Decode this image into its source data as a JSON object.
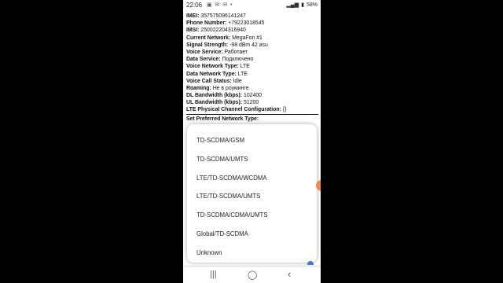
{
  "status": {
    "time": "22:06",
    "notifications": "▣ ✉ ✉ •",
    "battery": "58%"
  },
  "info": {
    "rows": [
      {
        "label": "IMEI:",
        "value": " 357575096141247"
      },
      {
        "label": "Phone Number:",
        "value": " +79223018545"
      },
      {
        "label": "IMSI:",
        "value": " 250022204316940"
      },
      {
        "label": "Current Network:",
        "value": " MegaFon #1"
      },
      {
        "label": "Signal Strength:",
        "value": " -98 dBm   42 asu"
      },
      {
        "label": "Voice Service:",
        "value": " Работает"
      },
      {
        "label": "Data Service:",
        "value": " Подключено"
      },
      {
        "label": "Voice Network Type:",
        "value": " LTE"
      },
      {
        "label": "Data Network Type:",
        "value": " LTE"
      },
      {
        "label": "Voice Call Status:",
        "value": " Idle"
      },
      {
        "label": "Roaming:",
        "value": " Не в роуминге"
      },
      {
        "label": "DL Bandwidth (kbps):",
        "value": " 102400"
      },
      {
        "label": "UL Bandwidth (kbps):",
        "value": " 51200"
      },
      {
        "label": "LTE Physical Channel Configuration:",
        "value": " {}"
      }
    ],
    "pref_label": "Set Preferred Network Type:"
  },
  "dialog": {
    "options": [
      "TD-SCDMA/GSM",
      "TD-SCDMA/UMTS",
      "LTE/TD-SCDMA/WCDMA",
      "LTE/TD-SCDMA/UMTS",
      "TD-SCDMA/CDMA/UMTS",
      "Global/TD-SCDMA",
      "Unknown"
    ]
  },
  "nav": {
    "recents": "|||",
    "home": "◯",
    "back": "‹"
  },
  "colors": {
    "edge_handle": "#f08a4b",
    "accent": "#3b78e7"
  }
}
